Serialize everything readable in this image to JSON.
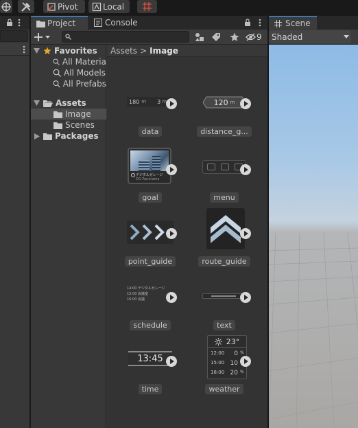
{
  "toolbar": {
    "pivot_label": "Pivot",
    "local_label": "Local"
  },
  "project_panel": {
    "tabs": [
      {
        "label": "Project",
        "icon": "folder-icon"
      },
      {
        "label": "Console",
        "icon": "console-icon"
      }
    ],
    "create_button_icon": "plus-dropdown-icon",
    "search": {
      "placeholder": "",
      "value": ""
    },
    "hidden_count": "9",
    "tree": {
      "favorites": {
        "label": "Favorites",
        "items": [
          "All Materia",
          "All Models",
          "All Prefabs"
        ]
      },
      "assets": {
        "label": "Assets",
        "children": [
          "Image",
          "Scenes"
        ],
        "selected": "Image"
      },
      "packages": {
        "label": "Packages"
      }
    },
    "breadcrumb": {
      "root": "Assets",
      "separator": ">",
      "current": "Image"
    },
    "assets": [
      {
        "name": "data",
        "preview": {
          "left": "180",
          "unit": "m",
          "right": "3",
          "right_unit": "m"
        }
      },
      {
        "name": "distance_g...",
        "preview": {
          "value": "120",
          "unit": "m"
        }
      },
      {
        "name": "goal",
        "preview": {
          "line1": "デジタルガレージ",
          "line2": "DG Panorama"
        }
      },
      {
        "name": "menu"
      },
      {
        "name": "point_guide"
      },
      {
        "name": "route_guide"
      },
      {
        "name": "schedule",
        "preview": {
          "rows": [
            {
              "time": "14:00",
              "text": "デジタルガレージ"
            },
            {
              "time": "15:00",
              "text": "会議室"
            },
            {
              "time": "16:00",
              "text": "会議"
            }
          ]
        }
      },
      {
        "name": "text"
      },
      {
        "name": "time",
        "preview": {
          "value": "13:45"
        }
      },
      {
        "name": "weather",
        "preview": {
          "temp": "23°",
          "rows": [
            {
              "time": "12:00",
              "value": "0",
              "unit": "%"
            },
            {
              "time": "15:00",
              "value": "10",
              "unit": "%"
            },
            {
              "time": "18:00",
              "value": "20",
              "unit": "%"
            }
          ]
        }
      }
    ]
  },
  "scene_panel": {
    "tab_label": "Scene",
    "tab_icon": "grid-icon",
    "shading_mode": "Shaded"
  },
  "colors": {
    "accent": "#3a79bb",
    "panel": "#383838",
    "grid_bg": "#333333",
    "sky": "#8dbbe6",
    "ground": "#a9a7a4"
  }
}
